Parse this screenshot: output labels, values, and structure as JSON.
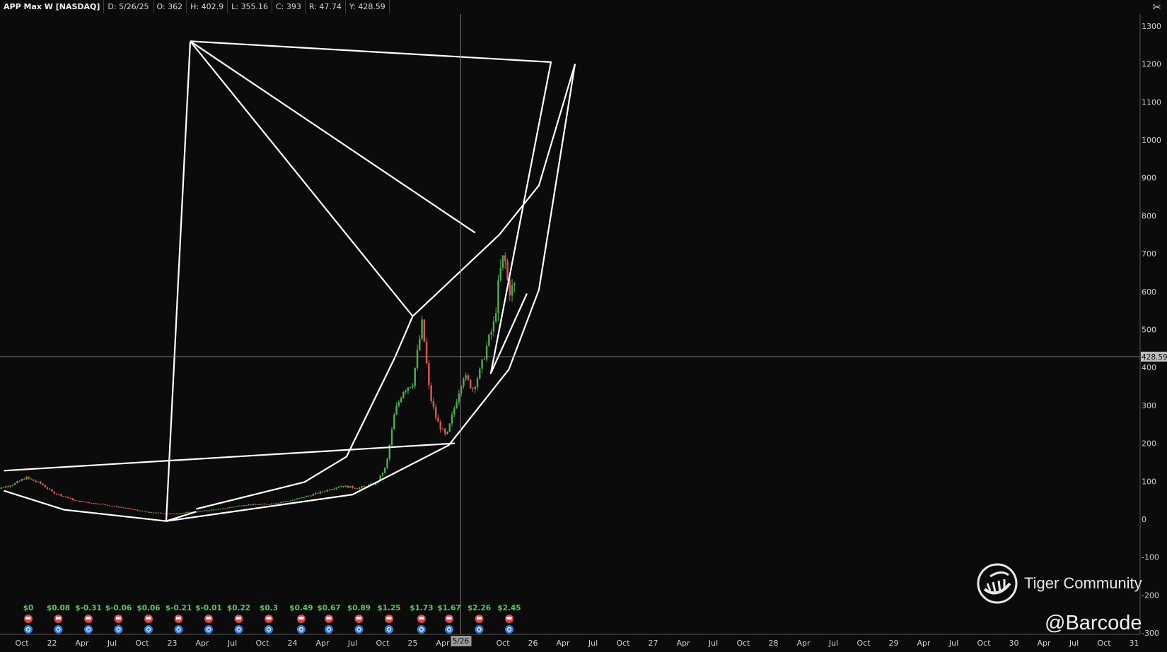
{
  "header": {
    "symbol": "APP Max W [NASDAQ]",
    "date": "D: 5/26/25",
    "open": "O: 362",
    "high": "H: 402.9",
    "low": "L: 355.16",
    "close": "C: 393",
    "range": "R: 47.74",
    "y_readout": "Y: 428.59"
  },
  "toolbar_icon": "crossed-tools-icon",
  "watermark": {
    "brand": "Tiger Community",
    "handle": "@Barcode"
  },
  "colors": {
    "up": "#4caf50",
    "down": "#e05555",
    "drawing": "#ffffff",
    "background": "#0b0b0b",
    "eps_text": "#5cc85c"
  },
  "chart_data": {
    "type": "candlestick",
    "title": "APP Max W [NASDAQ]",
    "ylim": [
      -300,
      1350
    ],
    "yticks": [
      1300,
      1200,
      1100,
      1000,
      900,
      800,
      700,
      600,
      500,
      400,
      300,
      200,
      100,
      0,
      -100,
      -200,
      -300
    ],
    "crosshair": {
      "x_label": "5/26",
      "y_label": "428.59"
    },
    "xtick_labels": [
      {
        "t": 2021.75,
        "label": "Oct"
      },
      {
        "t": 2022.0,
        "label": "22"
      },
      {
        "t": 2022.25,
        "label": "Apr"
      },
      {
        "t": 2022.5,
        "label": "Jul"
      },
      {
        "t": 2022.75,
        "label": "Oct"
      },
      {
        "t": 2023.0,
        "label": "23"
      },
      {
        "t": 2023.25,
        "label": "Apr"
      },
      {
        "t": 2023.5,
        "label": "Jul"
      },
      {
        "t": 2023.75,
        "label": "Oct"
      },
      {
        "t": 2024.0,
        "label": "24"
      },
      {
        "t": 2024.25,
        "label": "Apr"
      },
      {
        "t": 2024.5,
        "label": "Jul"
      },
      {
        "t": 2024.75,
        "label": "Oct"
      },
      {
        "t": 2025.0,
        "label": "25"
      },
      {
        "t": 2025.25,
        "label": "Apr"
      },
      {
        "t": 2025.75,
        "label": "Oct"
      },
      {
        "t": 2026.0,
        "label": "26"
      },
      {
        "t": 2026.25,
        "label": "Apr"
      },
      {
        "t": 2026.5,
        "label": "Jul"
      },
      {
        "t": 2026.75,
        "label": "Oct"
      },
      {
        "t": 2027.0,
        "label": "27"
      },
      {
        "t": 2027.25,
        "label": "Apr"
      },
      {
        "t": 2027.5,
        "label": "Jul"
      },
      {
        "t": 2027.75,
        "label": "Oct"
      },
      {
        "t": 2028.0,
        "label": "28"
      },
      {
        "t": 2028.25,
        "label": "Apr"
      },
      {
        "t": 2028.5,
        "label": "Jul"
      },
      {
        "t": 2028.75,
        "label": "Oct"
      },
      {
        "t": 2029.0,
        "label": "29"
      },
      {
        "t": 2029.25,
        "label": "Apr"
      },
      {
        "t": 2029.5,
        "label": "Jul"
      },
      {
        "t": 2029.75,
        "label": "Oct"
      },
      {
        "t": 2030.0,
        "label": "30"
      },
      {
        "t": 2030.25,
        "label": "Apr"
      },
      {
        "t": 2030.5,
        "label": "Jul"
      },
      {
        "t": 2030.75,
        "label": "Oct"
      },
      {
        "t": 2031.0,
        "label": "31"
      }
    ],
    "price_path": [
      [
        2021.5,
        75
      ],
      [
        2021.7,
        95
      ],
      [
        2021.78,
        110
      ],
      [
        2021.9,
        95
      ],
      [
        2022.0,
        72
      ],
      [
        2022.2,
        48
      ],
      [
        2022.4,
        40
      ],
      [
        2022.6,
        30
      ],
      [
        2022.8,
        18
      ],
      [
        2023.0,
        14
      ],
      [
        2023.2,
        20
      ],
      [
        2023.4,
        27
      ],
      [
        2023.6,
        38
      ],
      [
        2023.8,
        40
      ],
      [
        2024.0,
        50
      ],
      [
        2024.2,
        68
      ],
      [
        2024.4,
        88
      ],
      [
        2024.55,
        82
      ],
      [
        2024.7,
        95
      ],
      [
        2024.78,
        140
      ],
      [
        2024.85,
        280
      ],
      [
        2024.92,
        340
      ],
      [
        2025.0,
        360
      ],
      [
        2025.08,
        520
      ],
      [
        2025.14,
        330
      ],
      [
        2025.2,
        260
      ],
      [
        2025.28,
        215
      ],
      [
        2025.36,
        310
      ],
      [
        2025.42,
        380
      ],
      [
        2025.5,
        345
      ],
      [
        2025.56,
        390
      ],
      [
        2025.62,
        460
      ],
      [
        2025.68,
        520
      ],
      [
        2025.72,
        640
      ],
      [
        2025.76,
        700
      ],
      [
        2025.8,
        600
      ],
      [
        2025.86,
        620
      ]
    ],
    "eps": [
      {
        "t": 2021.75,
        "v": "$0"
      },
      {
        "t": 2022.0,
        "v": "$0.08"
      },
      {
        "t": 2022.25,
        "v": "$-0.31"
      },
      {
        "t": 2022.5,
        "v": "$-0.06"
      },
      {
        "t": 2022.75,
        "v": "$0.06"
      },
      {
        "t": 2023.0,
        "v": "$-0.21"
      },
      {
        "t": 2023.25,
        "v": "$-0.01"
      },
      {
        "t": 2023.5,
        "v": "$0.22"
      },
      {
        "t": 2023.75,
        "v": "$0.3"
      },
      {
        "t": 2024.02,
        "v": "$0.49"
      },
      {
        "t": 2024.25,
        "v": "$0.67"
      },
      {
        "t": 2024.5,
        "v": "$0.89"
      },
      {
        "t": 2024.75,
        "v": "$1.25"
      },
      {
        "t": 2025.02,
        "v": "$1.73"
      },
      {
        "t": 2025.25,
        "v": "$1.67"
      },
      {
        "t": 2025.5,
        "v": "$2.26"
      },
      {
        "t": 2025.75,
        "v": "$2.45"
      }
    ],
    "drawings": [
      [
        [
          2021.6,
          128
        ],
        [
          2025.35,
          200
        ]
      ],
      [
        [
          2021.6,
          75
        ],
        [
          2022.1,
          25
        ],
        [
          2022.95,
          -5
        ],
        [
          2023.2,
          20
        ]
      ],
      [
        [
          2022.95,
          -5
        ],
        [
          2023.15,
          1260
        ]
      ],
      [
        [
          2023.15,
          1260
        ],
        [
          2026.15,
          1205
        ],
        [
          2025.65,
          385
        ],
        [
          2025.95,
          595
        ]
      ],
      [
        [
          2023.15,
          1260
        ],
        [
          2025.0,
          535
        ]
      ],
      [
        [
          2023.15,
          1260
        ],
        [
          2025.52,
          755
        ]
      ],
      [
        [
          2023.2,
          27
        ],
        [
          2024.1,
          98
        ],
        [
          2024.45,
          165
        ],
        [
          2024.85,
          425
        ],
        [
          2025.0,
          535
        ],
        [
          2025.72,
          750
        ],
        [
          2026.05,
          880
        ],
        [
          2026.35,
          1200
        ]
      ],
      [
        [
          2022.95,
          -5
        ],
        [
          2024.5,
          65
        ],
        [
          2025.3,
          195
        ],
        [
          2025.8,
          395
        ],
        [
          2026.05,
          605
        ],
        [
          2026.35,
          1200
        ]
      ]
    ]
  }
}
